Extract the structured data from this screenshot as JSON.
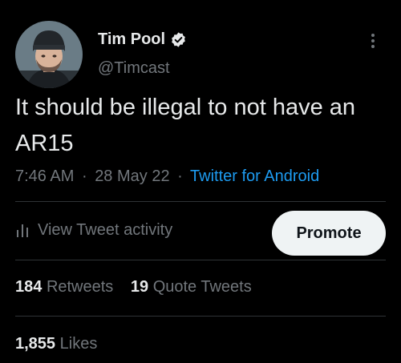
{
  "author": {
    "display_name": "Tim Pool",
    "handle": "@Timcast",
    "verified": true,
    "verified_color": "#e7e9ea"
  },
  "tweet": {
    "text": "It should be illegal to not have an AR15",
    "time": "7:46 AM",
    "date": "28 May 22",
    "separator": "·",
    "source": "Twitter for Android"
  },
  "actions": {
    "activity_label": "View Tweet activity",
    "promote_label": "Promote"
  },
  "stats": {
    "retweets_count": "184",
    "retweets_label": "Retweets",
    "quote_tweets_count": "19",
    "quote_tweets_label": "Quote Tweets",
    "likes_count": "1,855",
    "likes_label": "Likes"
  },
  "icons": {
    "avatar": "avatar-photo",
    "verified": "verified-badge-icon",
    "more": "more-vertical-icon",
    "activity": "bar-chart-icon"
  },
  "colors": {
    "background": "#000000",
    "primary_text": "#e7e9ea",
    "secondary_text": "#71767b",
    "link": "#1d9bf0",
    "divider": "#2f3336",
    "button_bg": "#eff3f4",
    "button_text": "#0f1419"
  }
}
